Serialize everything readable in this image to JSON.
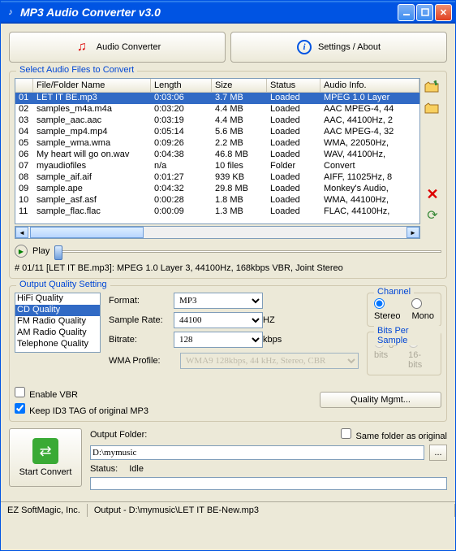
{
  "titlebar": {
    "title": "MP3 Audio Converter v3.0"
  },
  "toolbar": {
    "audio_converter": "Audio Converter",
    "settings_about": "Settings / About"
  },
  "files": {
    "legend": "Select Audio Files to Convert",
    "headers": {
      "num": "",
      "name": "File/Folder Name",
      "length": "Length",
      "size": "Size",
      "status": "Status",
      "info": "Audio Info."
    },
    "rows": [
      {
        "n": "01",
        "name": "LET IT BE.mp3",
        "length": "0:03:06",
        "size": "3.7 MB",
        "status": "Loaded",
        "info": "MPEG 1.0 Layer",
        "sel": true
      },
      {
        "n": "02",
        "name": "samples_m4a.m4a",
        "length": "0:03:20",
        "size": "4.4 MB",
        "status": "Loaded",
        "info": "AAC MPEG-4, 44"
      },
      {
        "n": "03",
        "name": "sample_aac.aac",
        "length": "0:03:19",
        "size": "4.4 MB",
        "status": "Loaded",
        "info": "AAC, 44100Hz, 2"
      },
      {
        "n": "04",
        "name": "sample_mp4.mp4",
        "length": "0:05:14",
        "size": "5.6 MB",
        "status": "Loaded",
        "info": "AAC MPEG-4, 32"
      },
      {
        "n": "05",
        "name": "sample_wma.wma",
        "length": "0:09:26",
        "size": "2.2 MB",
        "status": "Loaded",
        "info": "WMA, 22050Hz,"
      },
      {
        "n": "06",
        "name": "My heart will go on.wav",
        "length": "0:04:38",
        "size": "46.8 MB",
        "status": "Loaded",
        "info": "WAV, 44100Hz,"
      },
      {
        "n": "07",
        "name": "myaudiofiles",
        "length": "n/a",
        "size": "10 files",
        "status": "Folder",
        "info": "Convert <All supp"
      },
      {
        "n": "08",
        "name": "sample_aif.aif",
        "length": "0:01:27",
        "size": "939 KB",
        "status": "Loaded",
        "info": "AIFF, 11025Hz, 8"
      },
      {
        "n": "09",
        "name": "sample.ape",
        "length": "0:04:32",
        "size": "29.8 MB",
        "status": "Loaded",
        "info": "Monkey's Audio,"
      },
      {
        "n": "10",
        "name": "sample_asf.asf",
        "length": "0:00:28",
        "size": "1.8 MB",
        "status": "Loaded",
        "info": "WMA, 44100Hz,"
      },
      {
        "n": "11",
        "name": "sample_flac.flac",
        "length": "0:00:09",
        "size": "1.3 MB",
        "status": "Loaded",
        "info": "FLAC, 44100Hz,"
      }
    ]
  },
  "play": {
    "label": "Play",
    "info": "# 01/11 [LET IT BE.mp3]: MPEG 1.0 Layer 3, 44100Hz, 168kbps VBR, Joint Stereo"
  },
  "quality": {
    "legend": "Output Quality Setting",
    "presets": [
      "HiFi Quality",
      "CD Quality",
      "FM Radio Quality",
      "AM Radio Quality",
      "Telephone Quality"
    ],
    "selected_preset": 1,
    "format_label": "Format:",
    "format_value": "MP3",
    "rate_label": "Sample Rate:",
    "rate_value": "44100",
    "rate_unit": "HZ",
    "bitrate_label": "Bitrate:",
    "bitrate_value": "128",
    "bitrate_unit": "kbps",
    "wma_label": "WMA Profile:",
    "wma_value": "WMA9 128kbps, 44 kHz, Stereo, CBR",
    "channel_legend": "Channel",
    "stereo": "Stereo",
    "mono": "Mono",
    "bits_legend": "Bits Per Sample",
    "bits8": "8-bits",
    "bits16": "16-bits",
    "enable_vbr": "Enable VBR",
    "keep_id3": "Keep ID3 TAG of original MP3",
    "quality_mgmt": "Quality Mgmt..."
  },
  "output": {
    "start_convert": "Start Convert",
    "folder_label": "Output Folder:",
    "folder_value": "D:\\mymusic",
    "same_folder": "Same folder as original",
    "status_label": "Status:",
    "status_value": "Idle",
    "browse": "..."
  },
  "statusbar": {
    "company": "EZ SoftMagic, Inc.",
    "output": "Output - D:\\mymusic\\LET IT BE-New.mp3"
  }
}
